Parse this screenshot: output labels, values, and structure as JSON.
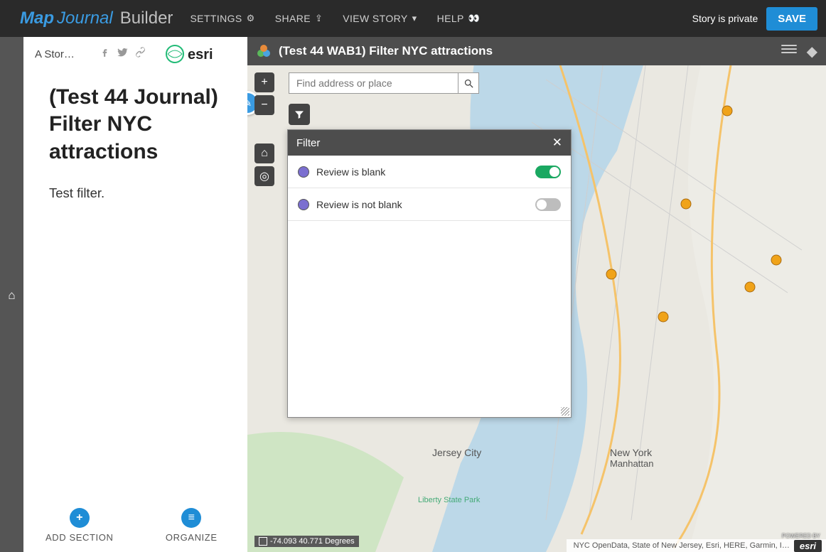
{
  "topbar": {
    "logo_map": "Map",
    "logo_journal": "Journal",
    "logo_builder": "Builder",
    "nav": {
      "settings": "SETTINGS",
      "share": "SHARE",
      "view": "VIEW STORY",
      "help": "HELP"
    },
    "privacy": "Story is private",
    "save": "SAVE"
  },
  "sidepanel": {
    "short_title": "A Stor…",
    "section_title": "(Test 44 Journal) Filter NYC attractions",
    "section_body": "Test filter.",
    "footer": {
      "add": "ADD SECTION",
      "organize": "ORGANIZE"
    }
  },
  "map": {
    "title": "(Test 44 WAB1) Filter NYC attractions",
    "search_placeholder": "Find address or place",
    "coords": "-74.093 40.771 Degrees",
    "attribution": "NYC OpenData, State of New Jersey, Esri, HERE, Garmin, I…",
    "poweredby": "POWERED BY",
    "esri": "esri"
  },
  "filter": {
    "title": "Filter",
    "rows": [
      {
        "label": "Review is blank",
        "on": true
      },
      {
        "label": "Review is not blank",
        "on": false
      }
    ]
  }
}
